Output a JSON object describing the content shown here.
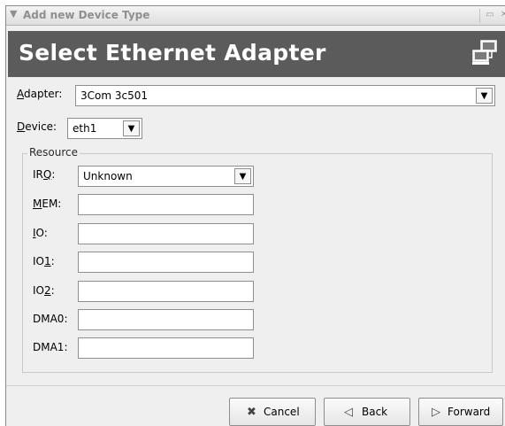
{
  "window": {
    "title": "Add new Device Type",
    "menu_icon": "chevron-down-icon",
    "controls": [
      "minimize-icon",
      "close-icon"
    ]
  },
  "header": {
    "title": "Select Ethernet Adapter",
    "icon": "network-computers-icon",
    "background": "#5b5b5b"
  },
  "form": {
    "adapter": {
      "label": "Adapter:",
      "value": "3Com 3c501"
    },
    "device": {
      "label": "Device:",
      "value": "eth1"
    },
    "resource": {
      "label": "Resource",
      "irq": {
        "label": "IRQ:",
        "value": "Unknown"
      },
      "mem": {
        "label": "MEM:",
        "value": ""
      },
      "io": {
        "label": "IO:",
        "value": ""
      },
      "io1": {
        "label": "IO1:",
        "value": ""
      },
      "io2": {
        "label": "IO2:",
        "value": ""
      },
      "dma0": {
        "label": "DMA0:",
        "value": ""
      },
      "dma1": {
        "label": "DMA1:",
        "value": ""
      }
    }
  },
  "buttons": {
    "cancel": {
      "label": "Cancel",
      "icon": "cancel-x-icon"
    },
    "back": {
      "label": "Back",
      "icon": "back-arrow-icon"
    },
    "forward": {
      "label": "Forward",
      "icon": "forward-arrow-icon"
    }
  }
}
